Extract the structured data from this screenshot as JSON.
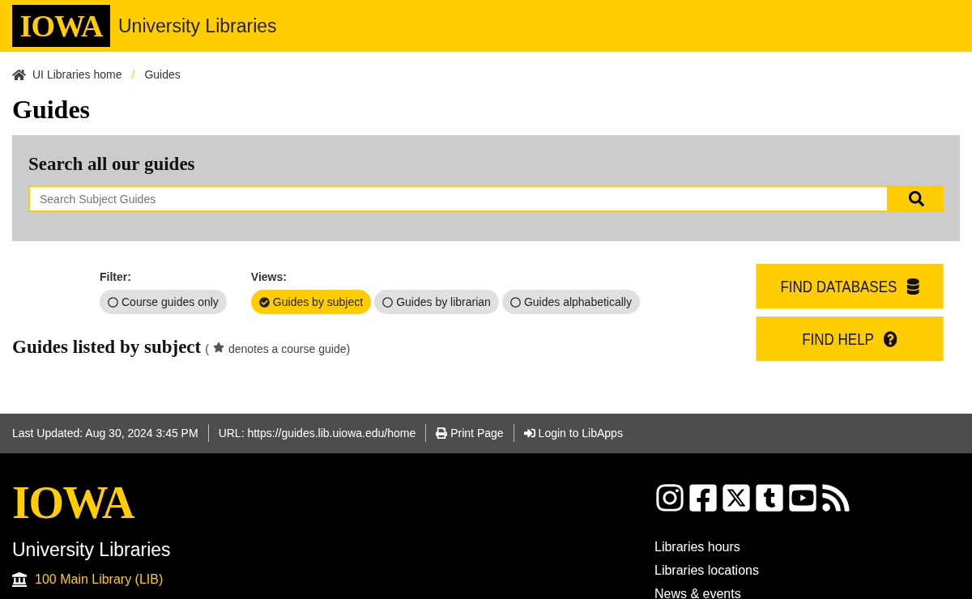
{
  "header": {
    "logo": "IOWA",
    "site_name": "University Libraries"
  },
  "breadcrumb": [
    {
      "label": "UI Libraries home",
      "kind": "home"
    },
    {
      "label": "Guides",
      "kind": "current"
    }
  ],
  "breadcrumb_separator": "/",
  "page_title": "Guides",
  "search": {
    "heading": "Search all our guides",
    "placeholder": "Search Subject Guides"
  },
  "filter": {
    "label": "Filter:",
    "options": [
      {
        "label": "Course guides only",
        "selected": false
      }
    ]
  },
  "views": {
    "label": "Views:",
    "options": [
      {
        "label": "Guides by subject",
        "selected": true
      },
      {
        "label": "Guides by librarian",
        "selected": false
      },
      {
        "label": "Guides alphabetically",
        "selected": false
      }
    ]
  },
  "listing": {
    "heading": "Guides listed by subject",
    "note_open": "(",
    "note": "denotes a course guide)"
  },
  "action_buttons": [
    {
      "label": "FIND DATABASES",
      "kind": "databases"
    },
    {
      "label": "FIND HELP",
      "kind": "help"
    }
  ],
  "info_bar": [
    {
      "text": "Last Updated: Aug 30, 2024 3:45 PM",
      "kind": "text"
    },
    {
      "text": "URL: https://guides.lib.uiowa.edu/home",
      "kind": "text"
    },
    {
      "text": "Print Page",
      "kind": "print"
    },
    {
      "text": "Login to LibApps",
      "kind": "login"
    }
  ],
  "footer": {
    "logo": "IOWA",
    "name": "University Libraries",
    "addresses": [
      {
        "text": "100 Main Library (LIB)",
        "kind": "building"
      }
    ],
    "links": [
      "Libraries hours",
      "Libraries locations",
      "News & events"
    ]
  }
}
